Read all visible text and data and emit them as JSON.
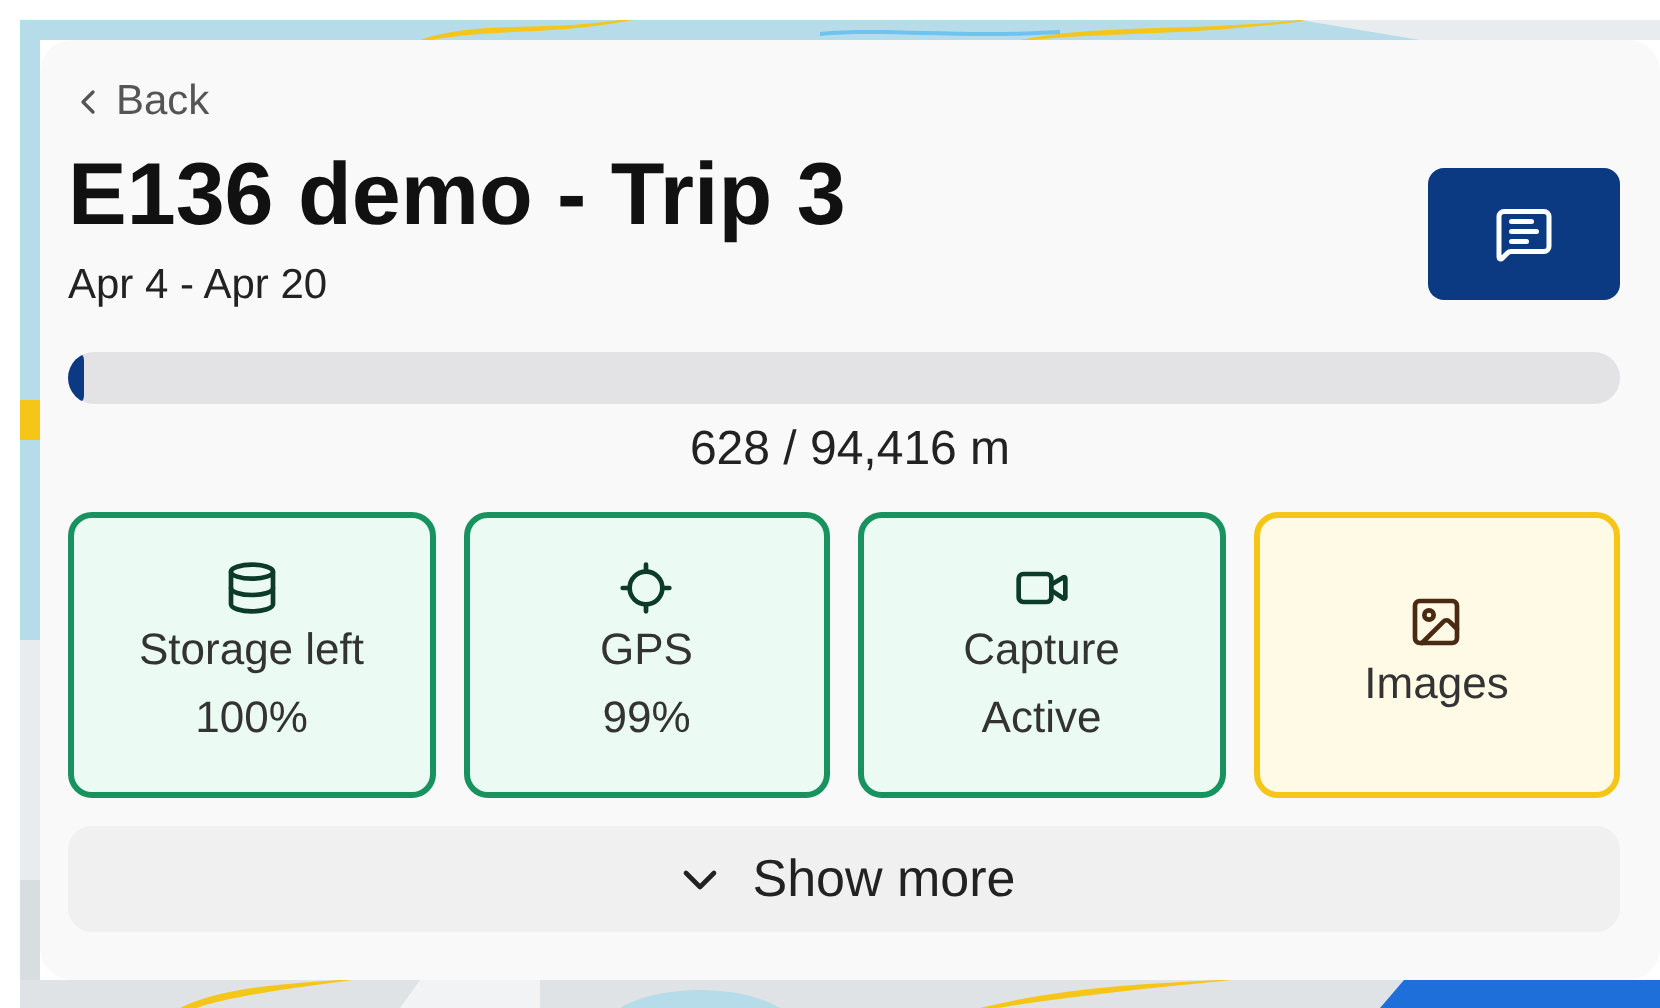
{
  "back_link": "Back",
  "trip": {
    "title": "E136 demo - Trip 3",
    "dates": "Apr 4 - Apr 20"
  },
  "progress": {
    "level": 0.01,
    "reading": "628 / 94,416 m"
  },
  "tiles": [
    {
      "kind": "storage",
      "color": "#18925e",
      "lines": [
        "Storage left",
        "100%"
      ]
    },
    {
      "kind": "gps",
      "color": "#18925e",
      "lines": [
        "GPS",
        "99%"
      ]
    },
    {
      "kind": "capture",
      "color": "#18925e",
      "lines": [
        "Capture",
        "Active"
      ]
    },
    {
      "kind": "images",
      "color": "#f5c518",
      "lines": [
        "Images"
      ]
    }
  ],
  "show_more": {
    "label": "Show more",
    "expanded": false
  }
}
